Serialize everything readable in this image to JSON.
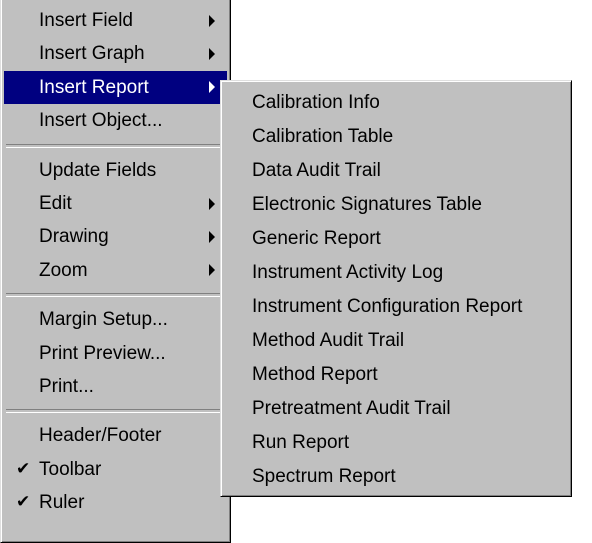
{
  "context_menu": {
    "groups": [
      [
        {
          "label": "Insert Field",
          "submenu": true
        },
        {
          "label": "Insert Graph",
          "submenu": true
        },
        {
          "label": "Insert Report",
          "submenu": true,
          "highlighted": true
        },
        {
          "label": "Insert Object...",
          "submenu": false
        }
      ],
      [
        {
          "label": "Update Fields",
          "submenu": false
        },
        {
          "label": "Edit",
          "submenu": true
        },
        {
          "label": "Drawing",
          "submenu": true
        },
        {
          "label": "Zoom",
          "submenu": true
        }
      ],
      [
        {
          "label": "Margin Setup...",
          "submenu": false
        },
        {
          "label": "Print Preview...",
          "submenu": false
        },
        {
          "label": "Print...",
          "submenu": false
        }
      ],
      [
        {
          "label": "Header/Footer",
          "submenu": false
        },
        {
          "label": "Toolbar",
          "checked": true
        },
        {
          "label": "Ruler",
          "checked": true
        }
      ]
    ]
  },
  "insert_report_submenu": {
    "items": [
      "Calibration Info",
      "Calibration Table",
      "Data Audit Trail",
      "Electronic Signatures Table",
      "Generic Report",
      "Instrument Activity Log",
      "Instrument Configuration Report",
      "Method Audit Trail",
      "Method Report",
      "Pretreatment Audit Trail",
      "Run Report",
      "Spectrum Report"
    ]
  },
  "colors": {
    "menu_face": "#c0c0c0",
    "highlight": "#000080",
    "highlight_text": "#ffffff"
  },
  "icons": {
    "submenu_arrow": "chevron-right-icon",
    "check": "checkmark-icon"
  }
}
